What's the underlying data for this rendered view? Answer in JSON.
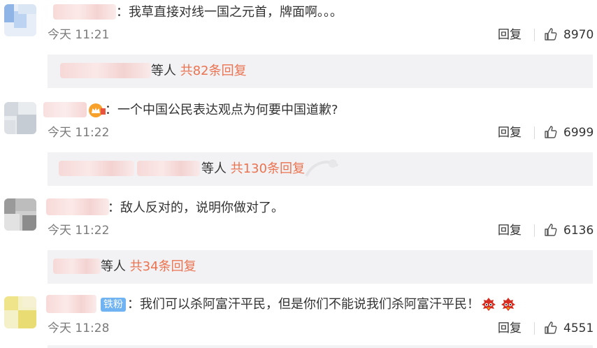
{
  "comments": [
    {
      "text": "：我草直接对线一国之元首，牌面啊。。。",
      "time": "今天 11:21",
      "reply_label": "回复",
      "likes": "8970",
      "thread_suffix": "等人",
      "thread_count": "共82条回复"
    },
    {
      "text": "：一个中国公民表达观点为何要中国道歉?",
      "time": "今天 11:22",
      "reply_label": "回复",
      "likes": "6999",
      "thread_suffix": "等人",
      "thread_count": "共130条回复"
    },
    {
      "text": "：敌人反对的，说明你做对了。",
      "time": "今天 11:22",
      "reply_label": "回复",
      "likes": "6136",
      "thread_suffix": "等人",
      "thread_count": "共34条回复"
    },
    {
      "badge": "铁粉",
      "text": "：我们可以杀阿富汗平民，但是你们不能说我们杀阿富汗平民！",
      "time": "今天 11:28",
      "reply_label": "回复",
      "likes": "4551"
    }
  ],
  "colors": {
    "accent": "#eb7350",
    "muted": "#7a7a7a",
    "reply_bg": "#f2f2f5",
    "badge": "#6fb3f2"
  },
  "icons": [
    "thumbs-up-icon",
    "vip-crown-icon",
    "angry-bird-emoji-icon"
  ]
}
